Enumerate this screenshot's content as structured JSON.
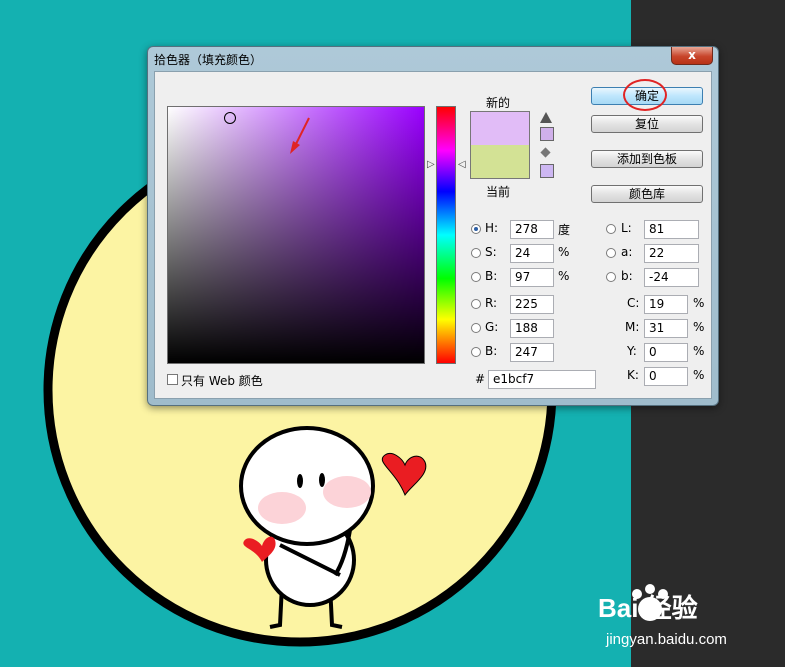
{
  "dialog": {
    "title": "拾色器（填充颜色）",
    "close_label": "x"
  },
  "swatches": {
    "new_label": "新的",
    "current_label": "当前",
    "new_color": "#e1bcf7",
    "current_color": "#d3e295"
  },
  "buttons": {
    "ok": "确定",
    "reset": "复位",
    "add_to_swatches": "添加到色板",
    "color_libraries": "颜色库"
  },
  "hsb": {
    "h_label": "H:",
    "h_value": "278",
    "h_unit": "度",
    "s_label": "S:",
    "s_value": "24",
    "s_unit": "%",
    "b_label": "B:",
    "b_value": "97",
    "b_unit": "%"
  },
  "rgb": {
    "r_label": "R:",
    "r_value": "225",
    "g_label": "G:",
    "g_value": "188",
    "b_label": "B:",
    "b_value": "247"
  },
  "lab": {
    "l_label": "L:",
    "l_value": "81",
    "a_label": "a:",
    "a_value": "22",
    "b_label": "b:",
    "b_value": "-24"
  },
  "cmyk": {
    "c_label": "C:",
    "c_value": "19",
    "m_label": "M:",
    "m_value": "31",
    "y_label": "Y:",
    "y_value": "0",
    "k_label": "K:",
    "k_value": "0",
    "unit": "%"
  },
  "hex": {
    "label": "#",
    "value": "e1bcf7"
  },
  "web_only": {
    "label": "只有 Web 颜色"
  },
  "watermark": {
    "brand": "Bai  经验",
    "url": "jingyan.baidu.com"
  },
  "colors": {
    "background": "#14b1b1",
    "annotation": "#e02424"
  }
}
